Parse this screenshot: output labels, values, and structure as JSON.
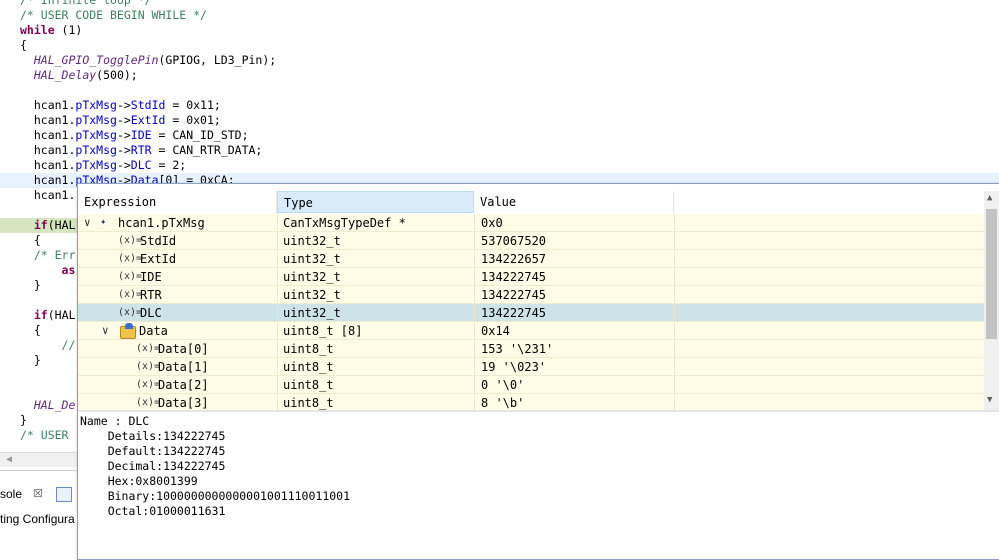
{
  "editor": {
    "lines": [
      {
        "text": "/* Infinite loop */",
        "style": "cm"
      },
      {
        "text": "/* USER CODE BEGIN WHILE */",
        "style": "cm"
      },
      {
        "text": "while (1)",
        "style": "kw"
      },
      {
        "text": "{",
        "style": "plain"
      },
      {
        "text": "  HAL_GPIO_TogglePin(GPIOG, LD3_Pin);",
        "style": "plain"
      },
      {
        "text": "  HAL_Delay(500);",
        "style": "plain"
      },
      {
        "text": "",
        "style": "plain"
      },
      {
        "text": "  hcan1.pTxMsg->StdId = 0x11;",
        "style": "plain"
      },
      {
        "text": "  hcan1.pTxMsg->ExtId = 0x01;",
        "style": "plain"
      },
      {
        "text": "  hcan1.pTxMsg->IDE = CAN_ID_STD;",
        "style": "plain"
      },
      {
        "text": "  hcan1.pTxMsg->RTR = CAN_RTR_DATA;",
        "style": "plain"
      },
      {
        "text": "  hcan1.pTxMsg->DLC = 2;",
        "style": "plain"
      },
      {
        "text": "  hcan1.pTxMsg->Data[0] = 0xCA;",
        "style": "plain"
      },
      {
        "text": "  hcan1.",
        "style": "plain"
      },
      {
        "text": "",
        "style": "plain"
      },
      {
        "text": "  if(HAL",
        "style": "kw"
      },
      {
        "text": "  {",
        "style": "plain"
      },
      {
        "text": "  /* Err",
        "style": "cm"
      },
      {
        "text": "      as",
        "style": "kw"
      },
      {
        "text": "  }",
        "style": "plain"
      },
      {
        "text": "",
        "style": "plain"
      },
      {
        "text": "  if(HAL",
        "style": "kw"
      },
      {
        "text": "  {",
        "style": "plain"
      },
      {
        "text": "      //",
        "style": "cm"
      },
      {
        "text": "  }",
        "style": "plain"
      },
      {
        "text": "",
        "style": "plain"
      },
      {
        "text": "",
        "style": "plain"
      },
      {
        "text": "  HAL_De",
        "style": "plain"
      },
      {
        "text": "}",
        "style": "plain"
      },
      {
        "text": "/* USER",
        "style": "cm"
      }
    ]
  },
  "console": {
    "tab_label": "sole",
    "close_glyph": "☒",
    "text": "ting Configura"
  },
  "popup": {
    "headers": {
      "expression": "Expression",
      "type": "Type",
      "value": "Value"
    },
    "rows": [
      {
        "expr": "hcan1.pTxMsg",
        "type": "CanTxMsgTypeDef *",
        "value": "0x0",
        "kind": "pointer",
        "indent": 0,
        "expanded": true
      },
      {
        "expr": "StdId",
        "type": "uint32_t",
        "value": "537067520",
        "kind": "var",
        "indent": 1
      },
      {
        "expr": "ExtId",
        "type": "uint32_t",
        "value": "134222657",
        "kind": "var",
        "indent": 1
      },
      {
        "expr": "IDE",
        "type": "uint32_t",
        "value": "134222745",
        "kind": "var",
        "indent": 1
      },
      {
        "expr": "RTR",
        "type": "uint32_t",
        "value": "134222745",
        "kind": "var",
        "indent": 1
      },
      {
        "expr": "DLC",
        "type": "uint32_t",
        "value": "134222745",
        "kind": "var",
        "indent": 1,
        "selected": true
      },
      {
        "expr": "Data",
        "type": "uint8_t [8]",
        "value": "0x14",
        "kind": "array",
        "indent": 1,
        "expanded": true
      },
      {
        "expr": "Data[0]",
        "type": "uint8_t",
        "value": "153 '\\231'",
        "kind": "var",
        "indent": 2
      },
      {
        "expr": "Data[1]",
        "type": "uint8_t",
        "value": "19 '\\023'",
        "kind": "var",
        "indent": 2
      },
      {
        "expr": "Data[2]",
        "type": "uint8_t",
        "value": "0 '\\0'",
        "kind": "var",
        "indent": 2
      },
      {
        "expr": "Data[3]",
        "type": "uint8_t",
        "value": "8 '\\b'",
        "kind": "var",
        "indent": 2
      }
    ],
    "var_icon_text": "(x)=",
    "details": {
      "name": "Name : DLC",
      "details": "    Details:134222745",
      "default": "    Default:134222745",
      "decimal": "    Decimal:134222745",
      "hex": "    Hex:0x8001399",
      "binary": "    Binary:1000000000000001001110011001",
      "octal": "    Octal:01000011631"
    }
  },
  "colors": {
    "row_bg": "#fffde8",
    "selected_row_bg": "#cde3e8",
    "keyword": "#7f0055",
    "comment": "#3f7f5f",
    "current_line": "#e8f2fe"
  }
}
